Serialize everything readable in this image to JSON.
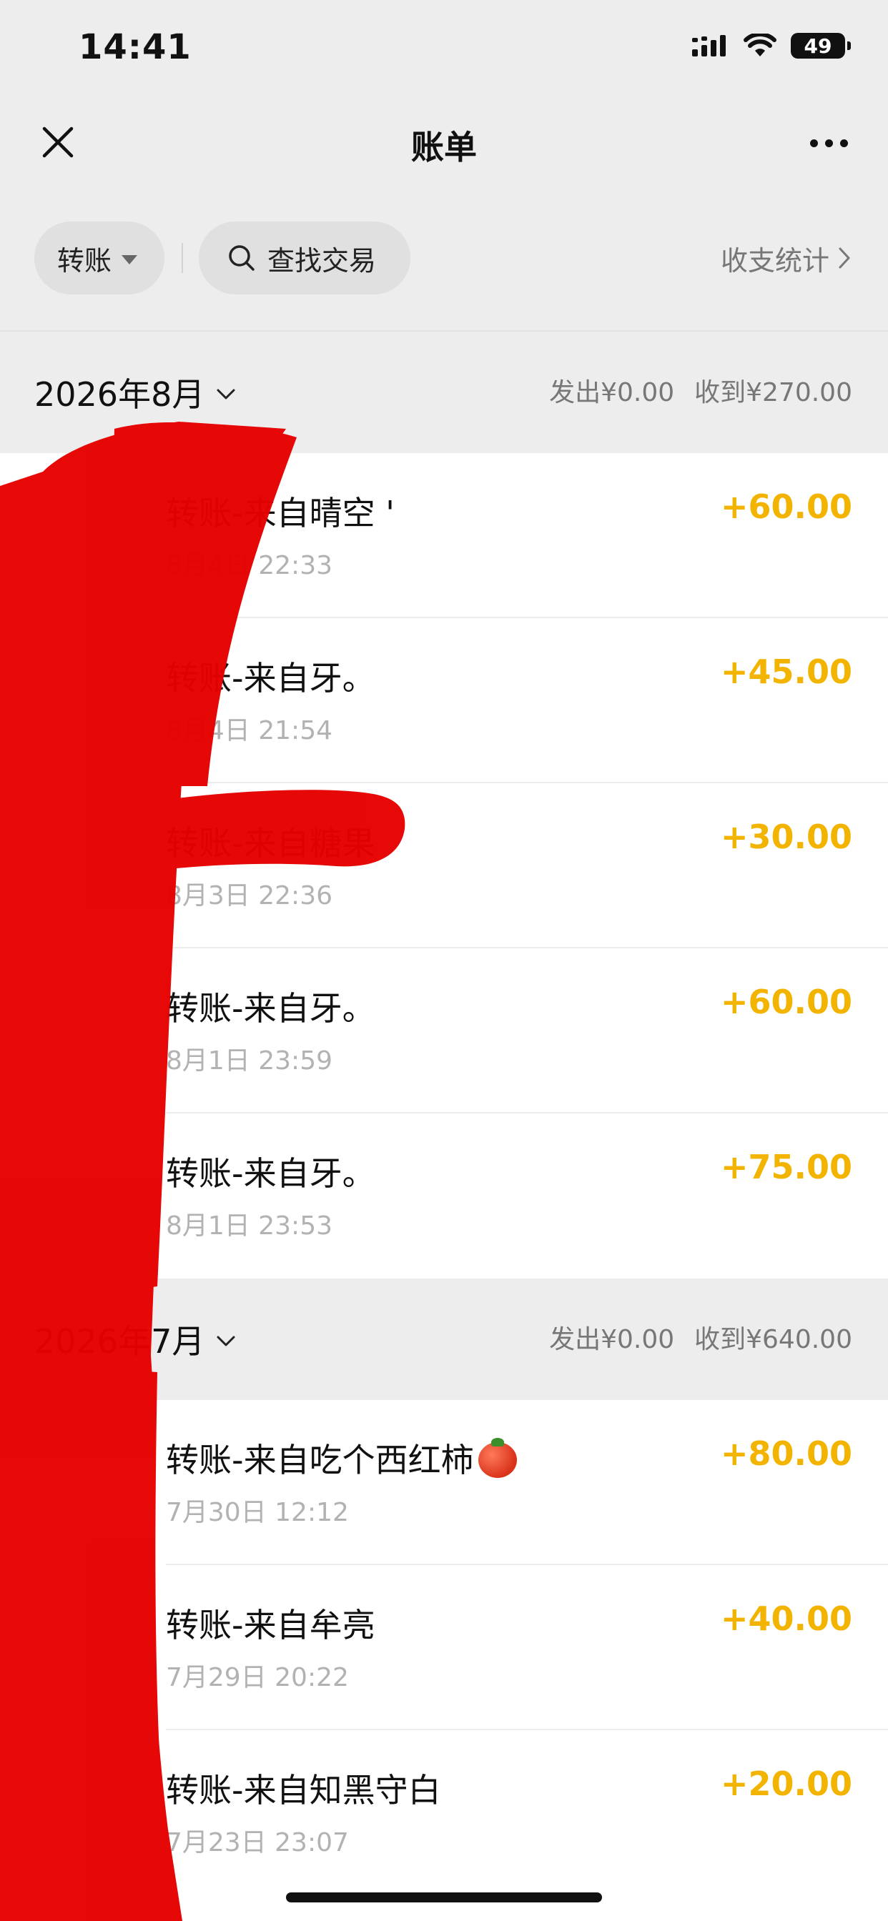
{
  "status_bar": {
    "time": "14:41",
    "battery": "49"
  },
  "nav": {
    "title": "账单"
  },
  "filters": {
    "type_chip": "转账",
    "search_label": "查找交易",
    "stats_label": "收支统计"
  },
  "months": [
    {
      "title": "2026年8月",
      "spent": "发出¥0.00",
      "received": "收到¥270.00",
      "transactions": [
        {
          "title": "转账-来自晴空 '",
          "time": "8月4日 22:33",
          "amount": "+60.00"
        },
        {
          "title": "转账-来自牙。",
          "time": "8月4日 21:54",
          "amount": "+45.00"
        },
        {
          "title": "转账-来自糖果",
          "time": "8月3日 22:36",
          "amount": "+30.00"
        },
        {
          "title": "转账-来自牙。",
          "time": "8月1日 23:59",
          "amount": "+60.00"
        },
        {
          "title": "转账-来自牙。",
          "time": "8月1日 23:53",
          "amount": "+75.00"
        }
      ]
    },
    {
      "title": "2026年7月",
      "spent": "发出¥0.00",
      "received": "收到¥640.00",
      "transactions": [
        {
          "title": "转账-来自吃个西红柿",
          "time": "7月30日 12:12",
          "amount": "+80.00",
          "emoji": "tomato-icon"
        },
        {
          "title": "转账-来自牟亮",
          "time": "7月29日 20:22",
          "amount": "+40.00"
        },
        {
          "title": "转账-来自知黑守白",
          "time": "7月23日 23:07",
          "amount": "+20.00"
        }
      ]
    }
  ],
  "colors": {
    "amount": "#f2b400",
    "background": "#ededed",
    "redaction": "#e60000"
  }
}
